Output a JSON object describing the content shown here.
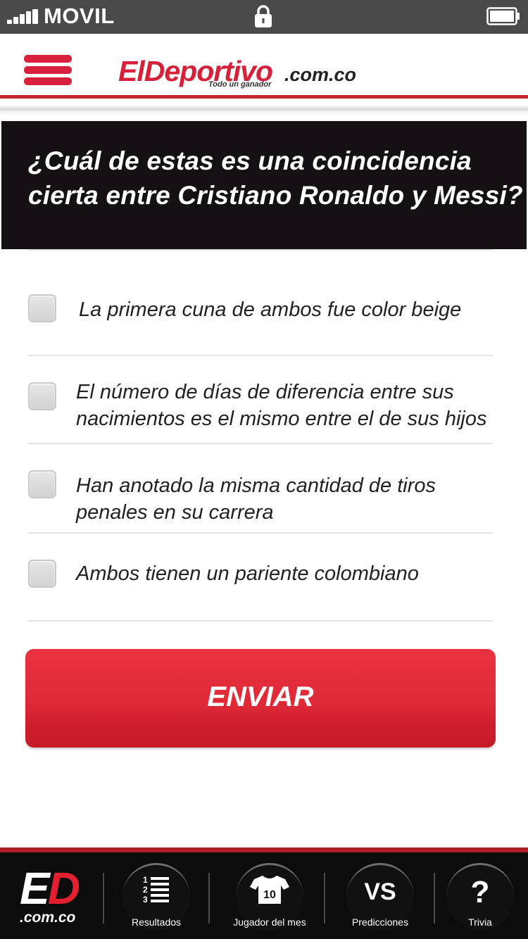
{
  "status_bar": {
    "carrier": "MOVIL",
    "signal_icon": "signal-bars-icon",
    "lock_icon": "lock-icon",
    "battery_icon": "battery-icon"
  },
  "header": {
    "menu_icon": "hamburger-menu-icon",
    "logo_main": "ElDeportivo",
    "logo_domain": ".com.co",
    "logo_tagline": "Todo un ganador"
  },
  "colors": {
    "brand_red": "#d7213a",
    "question_bg": "#141013",
    "nav_bg": "#0c0c0c"
  },
  "question": {
    "text": "¿Cuál de estas es una coincidencia cierta entre Cristiano Ronaldo y Messi?"
  },
  "options": [
    {
      "label": "La primera cuna de ambos fue color beige",
      "checked": false
    },
    {
      "label": "El número de días de diferencia entre sus nacimientos es el mismo entre el de sus hijos",
      "checked": false
    },
    {
      "label": "Han anotado la misma cantidad de tiros penales en su carrera",
      "checked": false
    },
    {
      "label": "Ambos tienen un pariente colombiano",
      "checked": false
    }
  ],
  "submit": {
    "label": "ENVIAR"
  },
  "bottom_nav": {
    "logo_letters_e": "E",
    "logo_letters_d": "D",
    "logo_domain": ".com.co",
    "items": [
      {
        "label": "Resultados",
        "icon": "numbered-list-icon"
      },
      {
        "label": "Jugador del mes",
        "icon": "jersey-icon",
        "icon_text": "10"
      },
      {
        "label": "Predicciones",
        "icon": "versus-icon",
        "icon_text": "VS"
      },
      {
        "label": "Trivia",
        "icon": "question-mark-icon",
        "icon_text": "?"
      }
    ]
  }
}
